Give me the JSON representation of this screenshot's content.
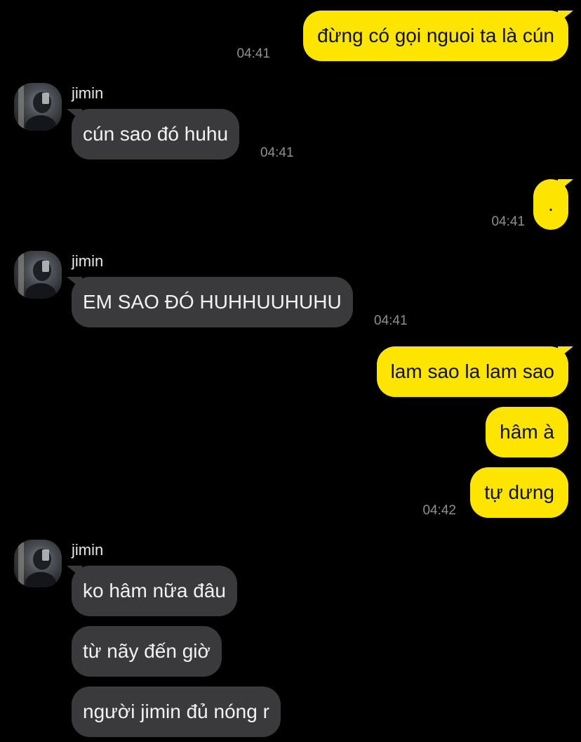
{
  "colors": {
    "background": "#000000",
    "outgoing_bubble": "#FEE500",
    "incoming_bubble": "#3A3A3C",
    "timestamp": "#8E8E93"
  },
  "contact": {
    "name": "jimin",
    "avatar_icon": "profile-photo"
  },
  "messages": [
    {
      "direction": "outgoing",
      "text": "đừng có gọi nguoi ta là cún",
      "time": "04:41"
    },
    {
      "direction": "incoming",
      "sender": "jimin",
      "text": "cún sao đó huhu",
      "time": "04:41"
    },
    {
      "direction": "outgoing",
      "text": ".",
      "time": "04:41"
    },
    {
      "direction": "incoming",
      "sender": "jimin",
      "text": "EM SAO ĐÓ HUHHUUHUHU",
      "time": "04:41"
    },
    {
      "direction": "outgoing",
      "text": "lam sao la lam sao"
    },
    {
      "direction": "outgoing",
      "text": "hâm à"
    },
    {
      "direction": "outgoing",
      "text": "tự dưng",
      "time": "04:42"
    },
    {
      "direction": "incoming",
      "sender": "jimin",
      "text": "ko hâm nữa đâu"
    },
    {
      "direction": "incoming",
      "text": "từ nãy đến giờ"
    },
    {
      "direction": "incoming",
      "text": "người jimin đủ nóng r"
    }
  ]
}
